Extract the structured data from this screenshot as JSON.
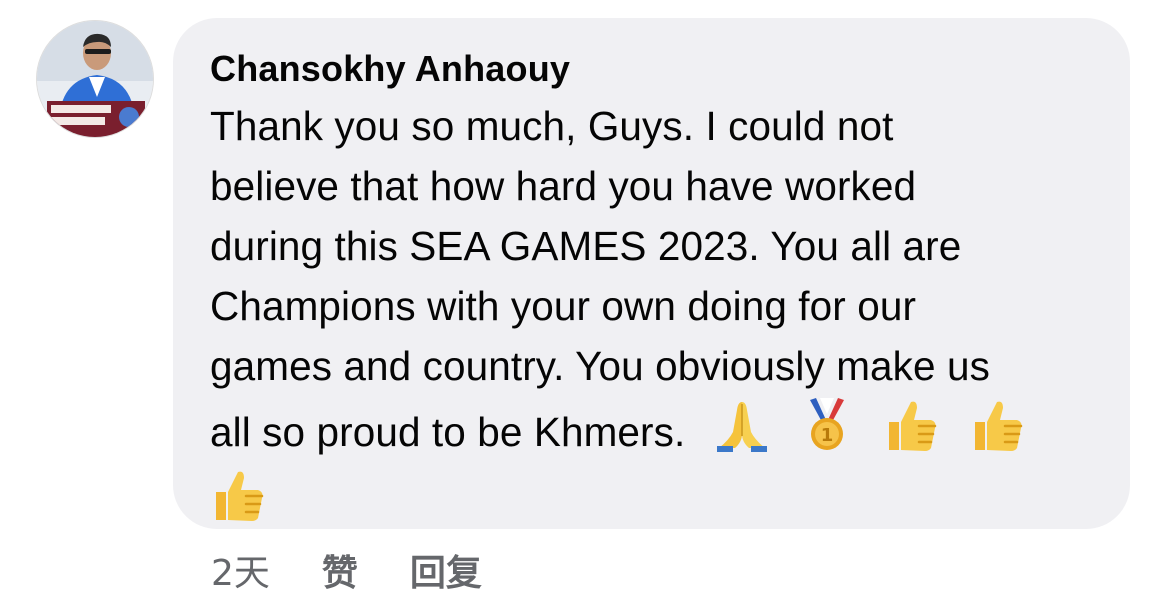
{
  "comment": {
    "author": "Chansokhy Anhaouy",
    "lines": [
      "Thank you so much, Guys. I could not",
      "believe that how hard you have worked",
      "during this SEA GAMES 2023. You all are",
      "Champions with your own doing for our",
      "games and country. You obviously make us",
      "all so proud to be Khmers."
    ],
    "emojis": [
      "folded-hands",
      "first-place-medal",
      "thumbs-up",
      "thumbs-up",
      "thumbs-up"
    ]
  },
  "actions": {
    "time": "2天",
    "like_label": "赞",
    "reply_label": "回复"
  },
  "colors": {
    "bubble": "#f0f0f3",
    "text": "#050505",
    "meta": "#65676b"
  }
}
